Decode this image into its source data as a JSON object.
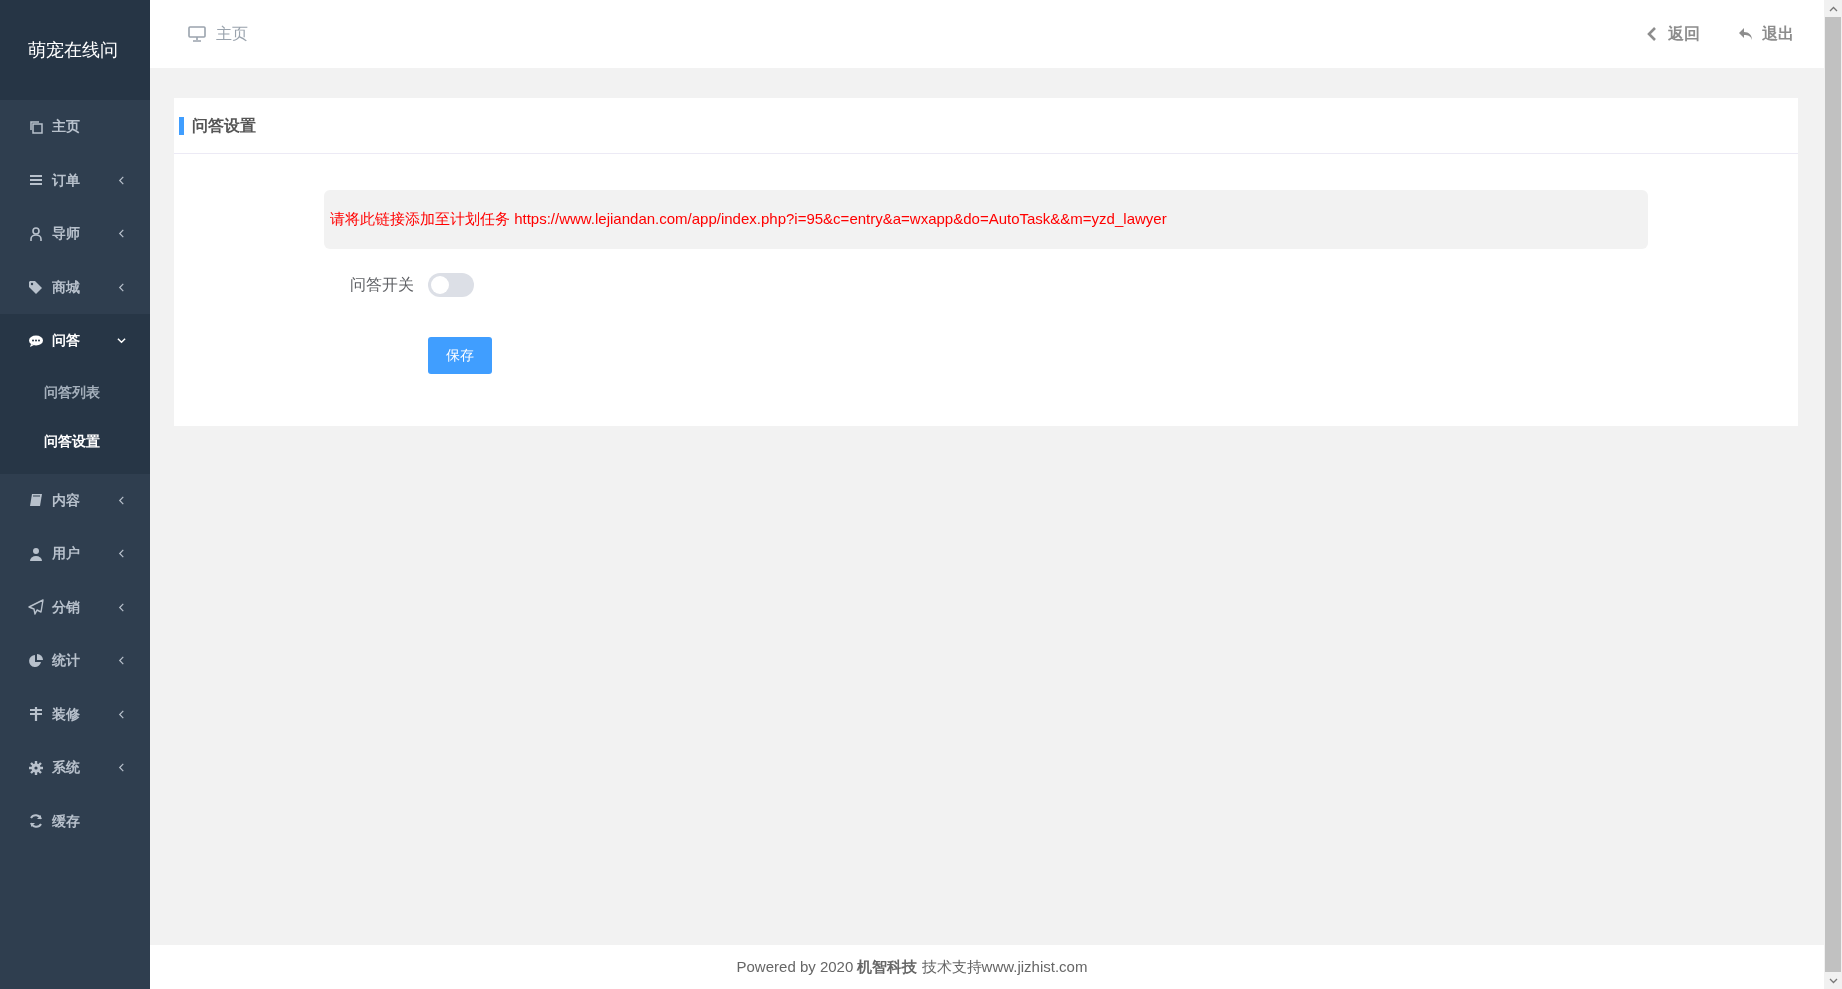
{
  "sidebar": {
    "logo": "萌宠在线问",
    "items": [
      {
        "label": "主页"
      },
      {
        "label": "订单",
        "expanded": false
      },
      {
        "label": "导师",
        "expanded": false
      },
      {
        "label": "商城",
        "expanded": false
      },
      {
        "label": "问答",
        "expanded": true,
        "children": [
          {
            "label": "问答列表",
            "selected": false
          },
          {
            "label": "问答设置",
            "selected": true
          }
        ]
      },
      {
        "label": "内容",
        "expanded": false
      },
      {
        "label": "用户",
        "expanded": false
      },
      {
        "label": "分销",
        "expanded": false
      },
      {
        "label": "统计",
        "expanded": false
      },
      {
        "label": "装修",
        "expanded": false
      },
      {
        "label": "系统",
        "expanded": false
      },
      {
        "label": "缓存"
      }
    ]
  },
  "topbar": {
    "breadcrumb": "主页",
    "actions": [
      {
        "label": "返回"
      },
      {
        "label": "退出"
      }
    ]
  },
  "panel": {
    "title": "问答设置",
    "notice": "请将此链接添加至计划任务 https://www.lejiandan.com/app/index.php?i=95&c=entry&a=wxapp&do=AutoTask&&m=yzd_lawyer",
    "fields": [
      {
        "label": "问答开关",
        "kind": "switch",
        "on": false
      }
    ],
    "save_button": "保存"
  },
  "footer": "Powered by 2020 **机智科技** 技术支持www.jizhist.com"
}
